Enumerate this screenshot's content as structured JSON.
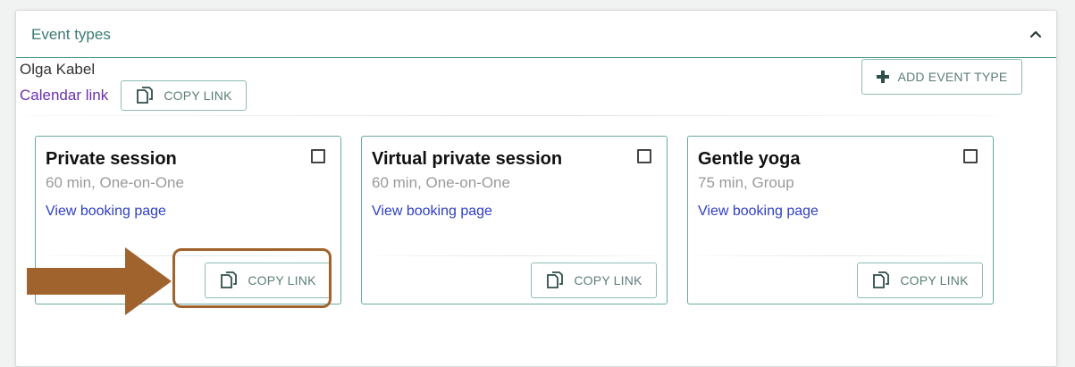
{
  "panel": {
    "title": "Event types",
    "collapse_icon": "chevron-up-icon"
  },
  "owner": {
    "name": "Olga Kabel",
    "calendar_link_label": "Calendar link",
    "copy_link_label": "COPY LINK"
  },
  "add_event_type": {
    "label": "ADD EVENT TYPE",
    "icon": "plus-icon"
  },
  "cards": [
    {
      "title": "Private session",
      "meta": "60 min, One-on-One",
      "view_link": "View booking page",
      "copy_link": "COPY LINK"
    },
    {
      "title": "Virtual private session",
      "meta": "60 min, One-on-One",
      "view_link": "View booking page",
      "copy_link": "COPY LINK"
    },
    {
      "title": "Gentle yoga",
      "meta": "75 min, Group",
      "view_link": "View booking page",
      "copy_link": "COPY LINK"
    }
  ],
  "colors": {
    "accent": "#3f8f83",
    "link": "#2f3fc4",
    "calendar_link": "#6a2fb0",
    "annotation": "#a0632d"
  }
}
